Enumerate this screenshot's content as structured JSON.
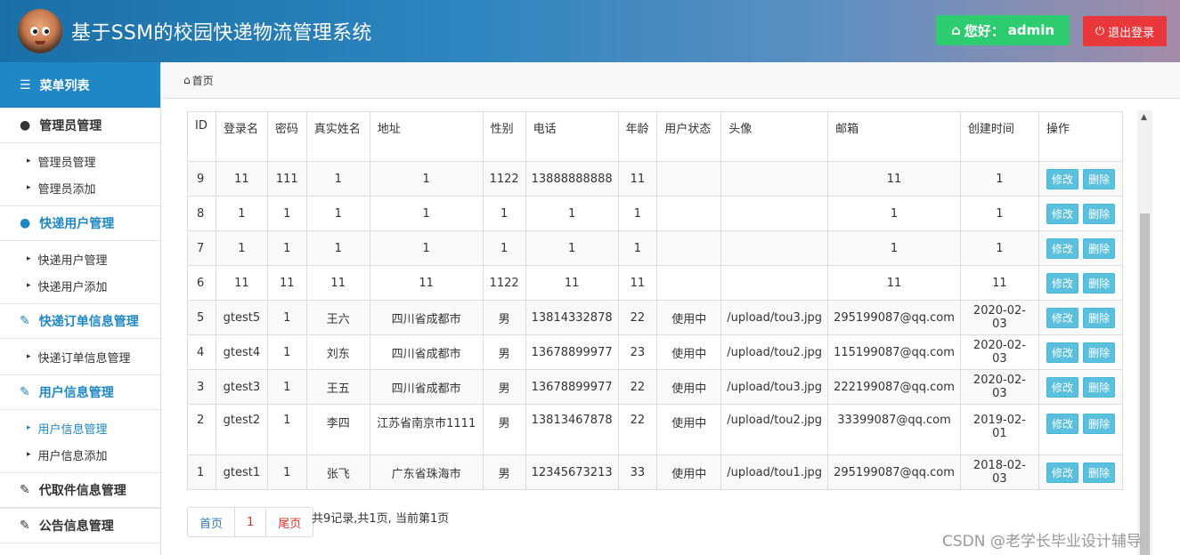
{
  "header": {
    "title": "基于SSM的校园快递物流管理系统",
    "hello_label": "您好：",
    "username": "admin",
    "logout_label": "退出登录"
  },
  "sidebar": {
    "menu_title": "菜单列表",
    "groups": [
      {
        "label": "管理员管理",
        "items": [
          "管理员管理",
          "管理员添加"
        ]
      },
      {
        "label": "快递用户管理",
        "items": [
          "快递用户管理",
          "快递用户添加"
        ]
      },
      {
        "label": "快递订单信息管理",
        "items": [
          "快递订单信息管理"
        ]
      },
      {
        "label": "用户信息管理",
        "items": [
          "用户信息管理",
          "用户信息添加"
        ]
      },
      {
        "label": "代取件信息管理",
        "items": []
      },
      {
        "label": "公告信息管理",
        "items": []
      }
    ]
  },
  "breadcrumb": {
    "home": "首页"
  },
  "table": {
    "columns": [
      "ID",
      "登录名",
      "密码",
      "真实姓名",
      "地址",
      "性别",
      "电话",
      "年龄",
      "用户状态",
      "头像",
      "邮箱",
      "创建时间",
      "操作"
    ],
    "edit_label": "修改",
    "delete_label": "删除",
    "rows": [
      [
        "9",
        "11",
        "111",
        "1",
        "1",
        "1122",
        "13888888888",
        "11",
        "",
        "",
        "11",
        "1"
      ],
      [
        "8",
        "1",
        "1",
        "1",
        "1",
        "1",
        "1",
        "1",
        "",
        "",
        "1",
        "1"
      ],
      [
        "7",
        "1",
        "1",
        "1",
        "1",
        "1",
        "1",
        "1",
        "",
        "",
        "1",
        "1"
      ],
      [
        "6",
        "11",
        "11",
        "11",
        "11",
        "1122",
        "11",
        "11",
        "",
        "",
        "11",
        "11"
      ],
      [
        "5",
        "gtest5",
        "1",
        "王六",
        "四川省成都市",
        "男",
        "13814332878",
        "22",
        "使用中",
        "/upload/tou3.jpg",
        "295199087@qq.com",
        "2020-02-03"
      ],
      [
        "4",
        "gtest4",
        "1",
        "刘东",
        "四川省成都市",
        "男",
        "13678899977",
        "23",
        "使用中",
        "/upload/tou2.jpg",
        "115199087@qq.com",
        "2020-02-03"
      ],
      [
        "3",
        "gtest3",
        "1",
        "王五",
        "四川省成都市",
        "男",
        "13678899977",
        "22",
        "使用中",
        "/upload/tou3.jpg",
        "222199087@qq.com",
        "2020-02-03"
      ],
      [
        "2",
        "gtest2",
        "1",
        "李四",
        "江苏省南京市1111",
        "男",
        "13813467878",
        "22",
        "使用中",
        "/upload/tou2.jpg",
        "33399087@qq.com",
        "2019-02-01"
      ],
      [
        "1",
        "gtest1",
        "1",
        "张飞",
        "广东省珠海市",
        "男",
        "12345673213",
        "33",
        "使用中",
        "/upload/tou1.jpg",
        "295199087@qq.com",
        "2018-02-03"
      ]
    ]
  },
  "pagination": {
    "first": "首页",
    "current": "1",
    "last": "尾页",
    "info": "共9记录,共1页, 当前第1页"
  },
  "watermark": "CSDN @老学长毕业设计辅导",
  "colors": {
    "header_start": "#1a6fa6",
    "accent": "#1f87c5",
    "hello_green": "#2ecc71",
    "logout_red": "#e8383c",
    "action_btn": "#5bc0de"
  }
}
